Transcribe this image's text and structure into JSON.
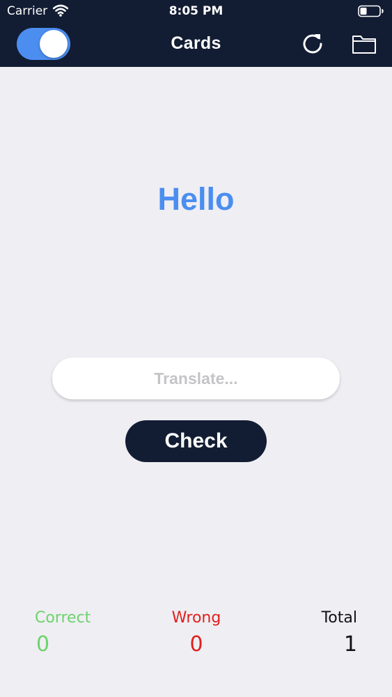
{
  "status_bar": {
    "carrier": "Carrier",
    "time": "8:05 PM",
    "icons": [
      "wifi-icon",
      "battery-icon"
    ]
  },
  "nav": {
    "title": "Cards",
    "toggle_on": true,
    "icons": [
      "refresh-icon",
      "folder-icon"
    ]
  },
  "card": {
    "word": "Hello"
  },
  "input": {
    "value": "",
    "placeholder": "Translate..."
  },
  "check_button": {
    "label": "Check"
  },
  "stats": {
    "correct": {
      "label": "Correct",
      "value": "0",
      "color": "#6cd36c"
    },
    "wrong": {
      "label": "Wrong",
      "value": "0",
      "color": "#e0201d"
    },
    "total": {
      "label": "Total",
      "value": "1",
      "color": "#111111"
    }
  },
  "colors": {
    "header_bg": "#121d33",
    "background": "#efeef3",
    "accent": "#4a8ef0"
  }
}
